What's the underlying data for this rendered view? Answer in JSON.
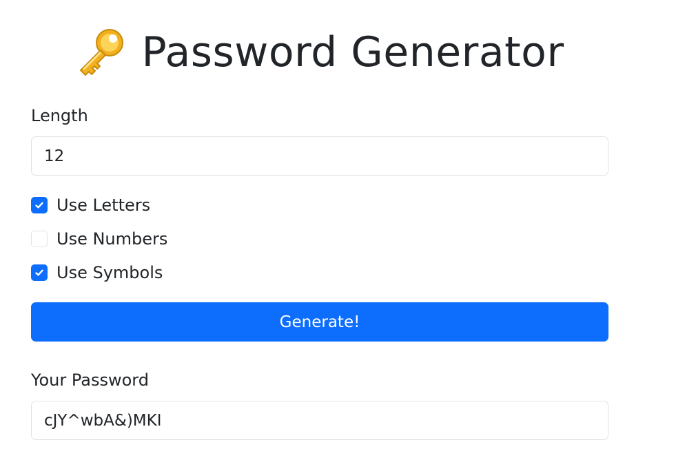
{
  "header": {
    "title": "Password Generator",
    "icon": "key-icon"
  },
  "length": {
    "label": "Length",
    "value": "12"
  },
  "options": [
    {
      "label": "Use Letters",
      "checked": true
    },
    {
      "label": "Use Numbers",
      "checked": false
    },
    {
      "label": "Use Symbols",
      "checked": true
    }
  ],
  "generate": {
    "label": "Generate!"
  },
  "result": {
    "label": "Your Password",
    "value": "cJY^wbA&)MKI"
  },
  "colors": {
    "accent": "#0d6efd",
    "border": "#dee2e6",
    "text": "#212529",
    "key_gold": "#f4b400"
  }
}
